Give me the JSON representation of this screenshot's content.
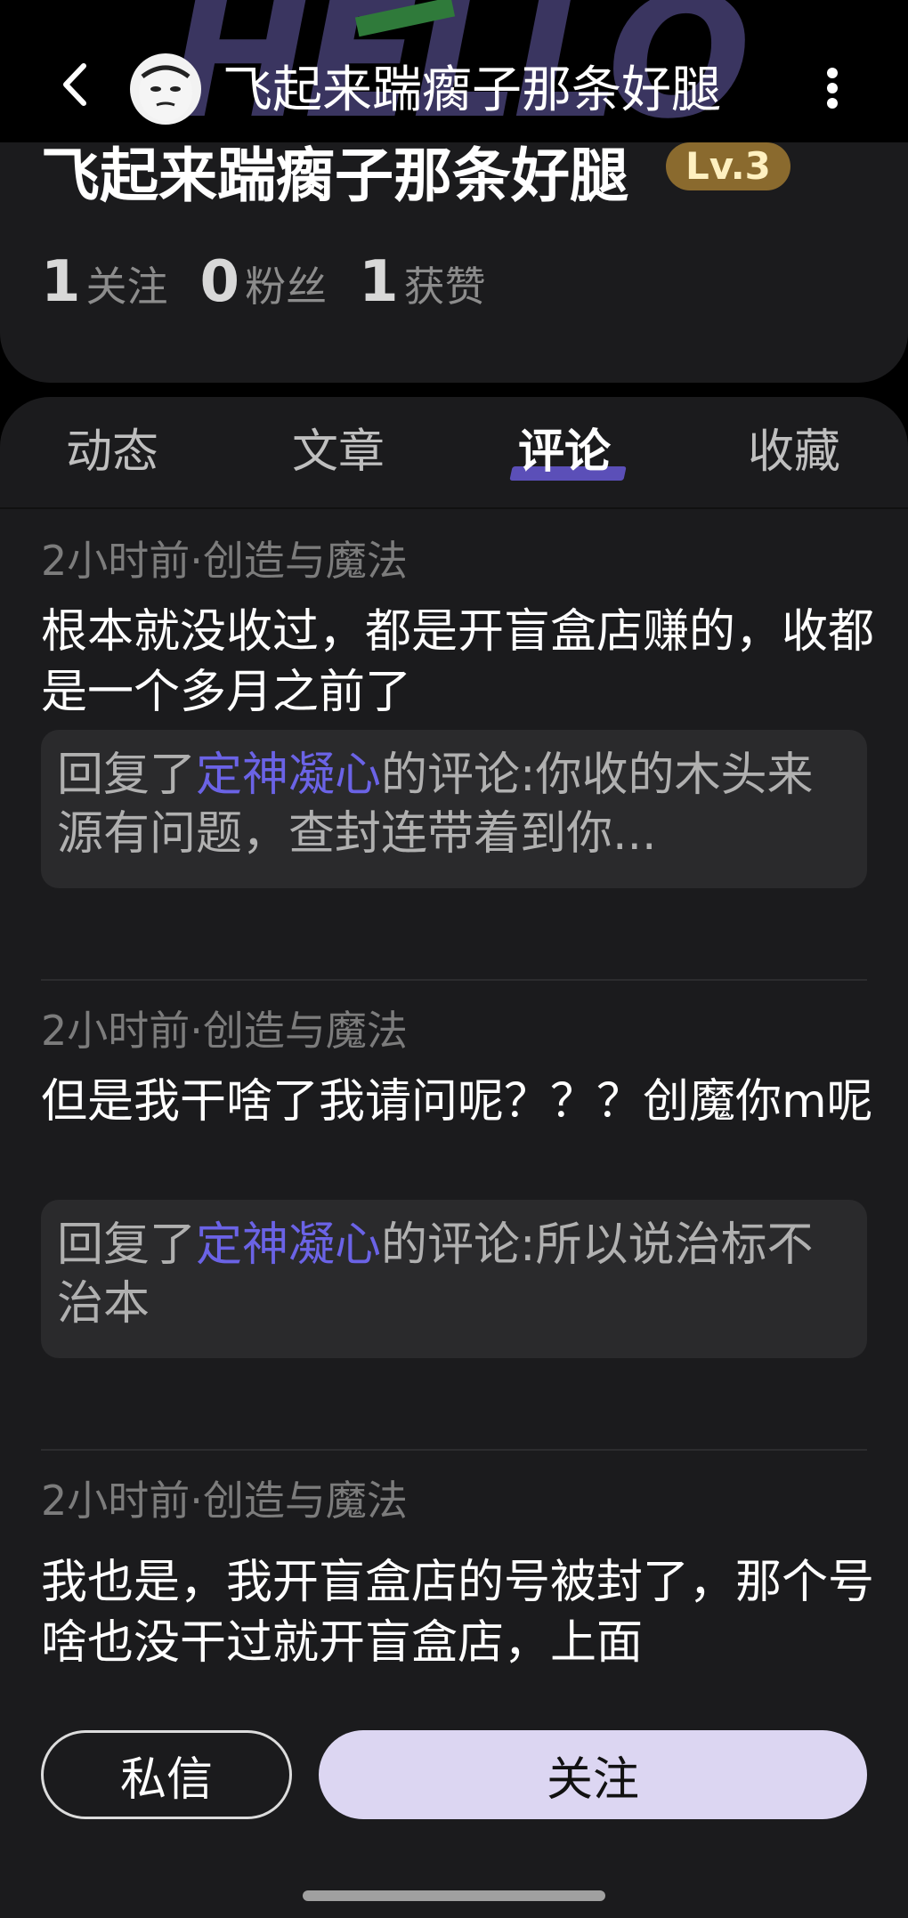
{
  "header": {
    "title": "飞起来踹瘸子那条好腿",
    "back_icon": "chevron-left-icon",
    "more_icon": "vertical-dots-icon",
    "banner_text": "HELLO"
  },
  "profile": {
    "name": "飞起来踹瘸子那条好腿",
    "level": "Lv.3",
    "stats": [
      {
        "value": "1",
        "label": "关注"
      },
      {
        "value": "0",
        "label": "粉丝"
      },
      {
        "value": "1",
        "label": "获赞"
      }
    ]
  },
  "tabs": [
    {
      "label": "动态"
    },
    {
      "label": "文章"
    },
    {
      "label": "评论",
      "active": true
    },
    {
      "label": "收藏"
    }
  ],
  "comments": [
    {
      "meta": "2小时前·创造与魔法",
      "text": "根本就没收过，都是开盲盒店赚的，收都是一个多月之前了",
      "quote_prefix": "回复了",
      "quote_mention": "定神凝心",
      "quote_text": "的评论:你收的木头来源有问题，查封连带着到你..."
    },
    {
      "meta": "2小时前·创造与魔法",
      "text": "但是我干啥了我请问呢？？？创魔你m呢",
      "quote_prefix": "回复了",
      "quote_mention": "定神凝心",
      "quote_text": "的评论:所以说治标不治本"
    },
    {
      "meta": "2小时前·创造与魔法",
      "text": "我也是，我开盲盒店的号被封了，那个号啥也没干过就开盲盒店，上面"
    }
  ],
  "bottom_bar": {
    "message_label": "私信",
    "follow_label": "关注"
  },
  "colors": {
    "background": "#000000",
    "card": "#1b1b1d",
    "accent": "#5b4fb8",
    "mention": "#6b63e6",
    "follow_button": "#dcd6f2",
    "level_badge": "#8a6a2e"
  }
}
